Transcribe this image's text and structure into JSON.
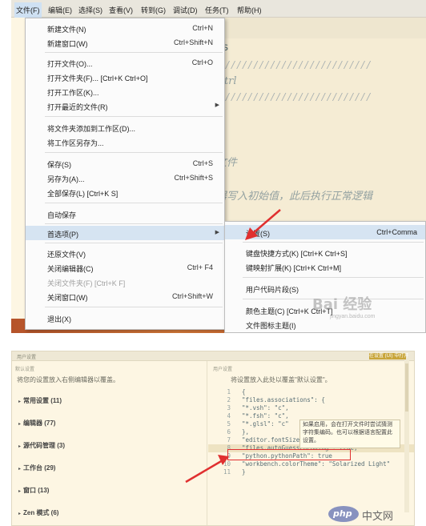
{
  "menubar": {
    "items": [
      "文件(F)",
      "编辑(E)",
      "选择(S)",
      "查看(V)",
      "转到(G)",
      "调试(D)",
      "任务(T)",
      "帮助(H)"
    ]
  },
  "editor": {
    "fragments": {
      "ps": "ps",
      "ctrl": "Ctrl",
      "hashes": "//////////////////////////",
      "file": "文件",
      "init": "器写入初始值，此后执行正常逻辑"
    }
  },
  "file_menu": {
    "items": [
      {
        "label": "新建文件(N)",
        "shortcut": "Ctrl+N"
      },
      {
        "label": "新建窗口(W)",
        "shortcut": "Ctrl+Shift+N"
      },
      {
        "label": "打开文件(O)...",
        "shortcut": "Ctrl+O"
      },
      {
        "label": "打开文件夹(F)... [Ctrl+K Ctrl+O]",
        "shortcut": ""
      },
      {
        "label": "打开工作区(K)...",
        "shortcut": ""
      },
      {
        "label": "打开最近的文件(R)",
        "shortcut": ""
      },
      {
        "label": "将文件夹添加到工作区(D)...",
        "shortcut": ""
      },
      {
        "label": "将工作区另存为...",
        "shortcut": ""
      },
      {
        "label": "保存(S)",
        "shortcut": "Ctrl+S"
      },
      {
        "label": "另存为(A)...",
        "shortcut": "Ctrl+Shift+S"
      },
      {
        "label": "全部保存(L) [Ctrl+K S]",
        "shortcut": ""
      },
      {
        "label": "自动保存",
        "shortcut": ""
      },
      {
        "label": "首选项(P)",
        "shortcut": ""
      },
      {
        "label": "还原文件(V)",
        "shortcut": ""
      },
      {
        "label": "关闭编辑器(C)",
        "shortcut": "Ctrl+ F4"
      },
      {
        "label": "关闭文件夹(F) [Ctrl+K F]",
        "shortcut": ""
      },
      {
        "label": "关闭窗口(W)",
        "shortcut": "Ctrl+Shift+W"
      },
      {
        "label": "退出(X)",
        "shortcut": ""
      }
    ]
  },
  "prefs_submenu": {
    "items": [
      {
        "label": "设置(S)",
        "shortcut": "Ctrl+Comma"
      },
      {
        "label": "键盘快捷方式(K) [Ctrl+K Ctrl+S]",
        "shortcut": ""
      },
      {
        "label": "键映射扩展(K) [Ctrl+K Ctrl+M]",
        "shortcut": ""
      },
      {
        "label": "用户代码片段(S)",
        "shortcut": ""
      },
      {
        "label": "颜色主题(C) [Ctrl+K Ctrl+T]",
        "shortcut": ""
      },
      {
        "label": "文件图标主题(I)",
        "shortcut": ""
      }
    ]
  },
  "watermark_top": {
    "text": "Bai 经验",
    "sub": "jingyan.baidu.com"
  },
  "settings": {
    "title": "用户设置",
    "open_button": "在设置 (UI) 中打开",
    "left_hint": "默认设置",
    "left_desc": "将您的设置放入右侧编辑器以覆盖。",
    "groups": [
      "常用设置 (11)",
      "编辑器 (77)",
      "源代码管理 (3)",
      "工作台 (29)",
      "窗口 (13)",
      "Zen 模式 (6)"
    ],
    "right_hint": "用户设置",
    "right_desc": "将设置放入此处以覆盖\"默认设置\"。",
    "code_lines": [
      {
        "n": "1",
        "text": "{"
      },
      {
        "n": "2",
        "text": "    \"files.associations\": {"
      },
      {
        "n": "3",
        "text": "        \"*.vsh\": \"c\","
      },
      {
        "n": "4",
        "text": "        \"*.fsh\": \"c\","
      },
      {
        "n": "5",
        "text": "        \"*.glsl\": \"c\""
      },
      {
        "n": "6",
        "text": "    },"
      },
      {
        "n": "7",
        "text": "    \"editor.fontSize\": 15,"
      },
      {
        "n": "8",
        "text": "    \"files.autoGuessEncoding\": true,"
      },
      {
        "n": "9",
        "text": "    \"python.pythonPath\": true"
      },
      {
        "n": "10",
        "text": "    \"workbench.colorTheme\": \"Solarized Light\""
      },
      {
        "n": "11",
        "text": "}"
      }
    ],
    "tooltip": "如果启用，会在打开文件时尝试猜测字符集编码。也可以根据语言配置此设置。"
  },
  "logo": {
    "php": "php",
    "cn": "中文网"
  },
  "colors": {
    "accent": "#e03030",
    "highlight": "#d6e4f2",
    "solarized_bg": "#fdf6e3"
  }
}
